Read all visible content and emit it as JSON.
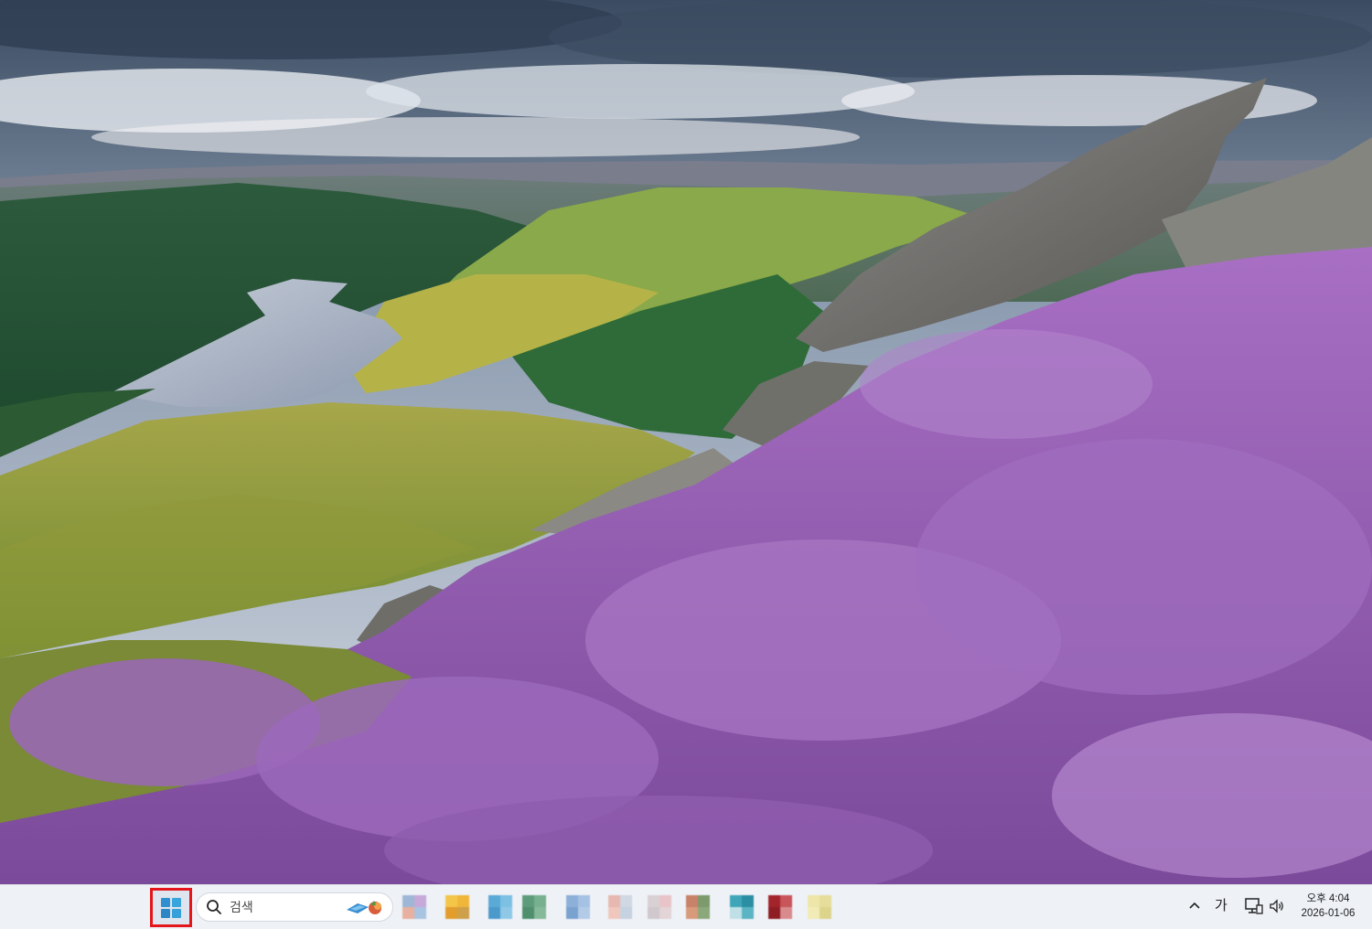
{
  "desktop": {
    "wallpaper": "landscape-wallpaper"
  },
  "taskbar": {
    "start_icon": "windows-logo-icon",
    "start_colors": [
      "#2f8fcf",
      "#3aa5dd",
      "#2b86c6",
      "#36a0d8"
    ],
    "search": {
      "placeholder": "검색",
      "icon": "search-icon"
    },
    "pinned_apps": [
      {
        "name": "app-1-icon",
        "colors": [
          "#9fb7d6",
          "#c6a9d8",
          "#e7b0a0",
          "#a9c4e0"
        ]
      },
      {
        "name": "app-2-icon",
        "colors": [
          "#f3c64a",
          "#f0b63a",
          "#e39d2c",
          "#cfa04a"
        ]
      },
      {
        "name": "app-3-icon",
        "colors": [
          "#5aa9d6",
          "#7cc0e3",
          "#4b9acb",
          "#8fc8e6"
        ]
      },
      {
        "name": "app-4-icon",
        "colors": [
          "#5d9c7a",
          "#77b08e",
          "#4f8f6d",
          "#86b99a"
        ]
      },
      {
        "name": "app-5-icon",
        "colors": [
          "#8db0d8",
          "#a5c1e3",
          "#7aa2cf",
          "#b4cbe8"
        ]
      },
      {
        "name": "app-6-icon",
        "colors": [
          "#e7b8b0",
          "#d0d8e3",
          "#f0c7bd",
          "#c6d2df"
        ]
      },
      {
        "name": "app-7-icon",
        "colors": [
          "#d9d0d3",
          "#e8c4c8",
          "#cfc8cc",
          "#e2d4d7"
        ]
      },
      {
        "name": "app-8-icon",
        "colors": [
          "#c8826a",
          "#7c9a6b",
          "#d79a7b",
          "#8aa87a"
        ]
      },
      {
        "name": "app-9-icon",
        "colors": [
          "#3ea6b8",
          "#2c8ea3",
          "#bfe0e6",
          "#5ab4c4"
        ]
      },
      {
        "name": "app-10-icon",
        "colors": [
          "#a4242b",
          "#c7555a",
          "#8f1d24",
          "#d98a8d"
        ]
      },
      {
        "name": "app-11-icon",
        "colors": [
          "#eee6a8",
          "#e6dd9a",
          "#f2ebb6",
          "#ddd48c"
        ]
      }
    ],
    "tray": {
      "chevron": "chevron-up-icon",
      "ime": "가",
      "network": "network-icon",
      "volume": "volume-icon"
    },
    "clock": {
      "time": "오후 4:04",
      "date": "2026-01-06"
    }
  }
}
